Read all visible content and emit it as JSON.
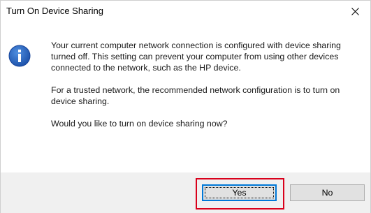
{
  "window": {
    "title": "Turn On Device Sharing",
    "close_icon": "close-icon"
  },
  "icon": {
    "name": "information-icon",
    "glyph": "i",
    "color": "#1e5eb8"
  },
  "message": {
    "paragraphs": [
      "Your current computer network connection is configured with device sharing turned off. This setting can prevent your computer from using other devices connected to the network, such as the HP device.",
      "For a trusted network, the recommended network configuration is to turn on device sharing.",
      "Would you like to turn on device sharing now?"
    ]
  },
  "buttons": {
    "yes_label": "Yes",
    "no_label": "No"
  },
  "colors": {
    "accent": "#0078d7",
    "highlight": "#d9001b",
    "footer_bg": "#f0f0f0"
  }
}
